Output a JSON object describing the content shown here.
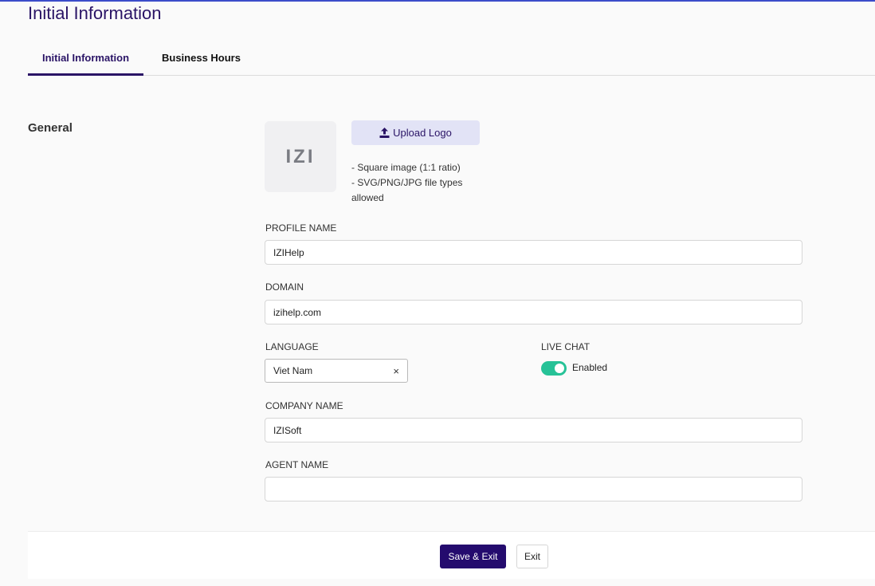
{
  "page": {
    "title": "Initial Information"
  },
  "tabs": [
    {
      "label": "Initial Information",
      "active": true
    },
    {
      "label": "Business Hours",
      "active": false
    }
  ],
  "general": {
    "section_title": "General",
    "logo_text": "IZI",
    "upload_button": "Upload Logo",
    "upload_icon": "upload-icon",
    "hints": [
      "- Square image (1:1 ratio)",
      "- SVG/PNG/JPG file types",
      "allowed"
    ]
  },
  "fields": {
    "profile_name": {
      "label": "PROFILE NAME",
      "value": "IZIHelp"
    },
    "domain": {
      "label": "DOMAIN",
      "value": "izihelp.com"
    },
    "language": {
      "label": "LANGUAGE",
      "value": "Viet Nam",
      "clear": "×"
    },
    "live_chat": {
      "label": "LIVE CHAT",
      "enabled": true,
      "status": "Enabled"
    },
    "company_name": {
      "label": "COMPANY NAME",
      "value": "IZISoft"
    },
    "agent_name": {
      "label": "AGENT NAME",
      "value": ""
    }
  },
  "footer": {
    "save_label": "Save & Exit",
    "exit_label": "Exit"
  },
  "colors": {
    "accent": "#2a1466",
    "toggle_on": "#26c297",
    "primary_button": "#240b6e"
  }
}
